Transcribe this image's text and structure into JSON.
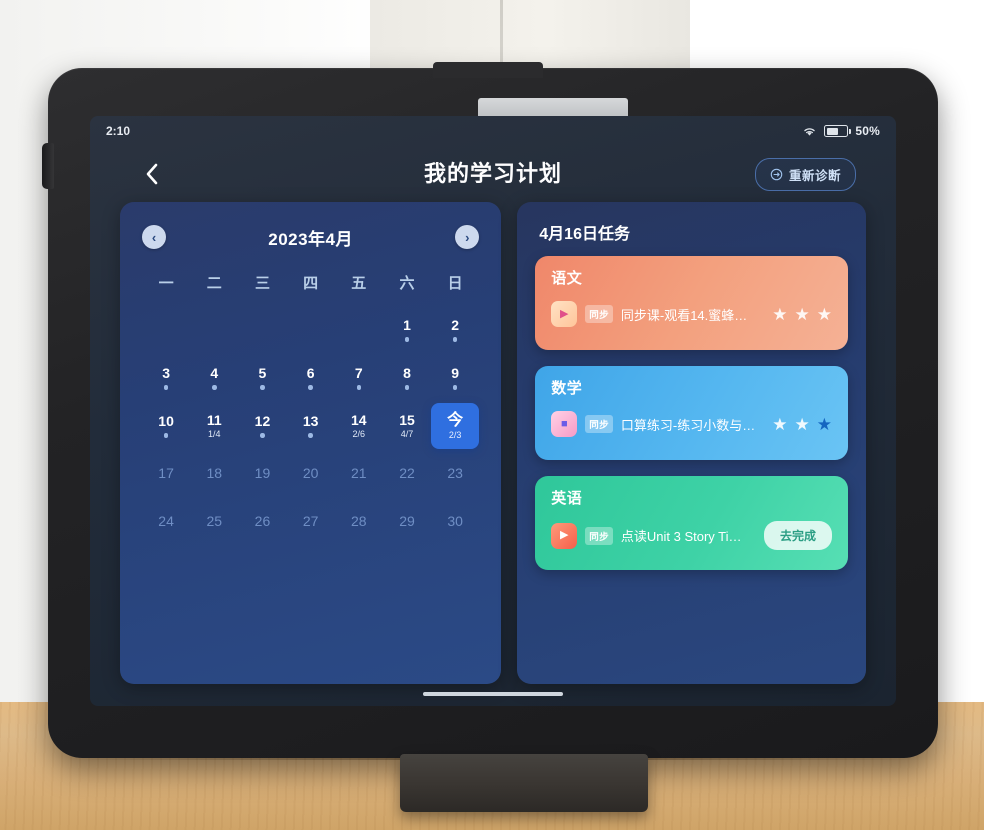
{
  "status_bar": {
    "time": "2:10",
    "wifi_icon": "wifi-icon",
    "battery_icon": "battery-icon",
    "battery_percent": "50%"
  },
  "nav": {
    "back_icon": "chevron-left-icon",
    "title": "我的学习计划",
    "rediagnose": {
      "icon": "refresh-circle-icon",
      "label": "重新诊断"
    }
  },
  "calendar": {
    "prev_icon": "chevron-left-icon",
    "next_icon": "chevron-right-icon",
    "month_title": "2023年4月",
    "weekdays": [
      "一",
      "二",
      "三",
      "四",
      "五",
      "六",
      "日"
    ],
    "leading_blanks": 5,
    "days": [
      {
        "num": "1",
        "dot": true,
        "frac": "",
        "state": "past"
      },
      {
        "num": "2",
        "dot": true,
        "frac": "",
        "state": "past"
      },
      {
        "num": "3",
        "dot": true,
        "frac": "",
        "state": "past"
      },
      {
        "num": "4",
        "dot": true,
        "frac": "",
        "state": "past"
      },
      {
        "num": "5",
        "dot": true,
        "frac": "",
        "state": "past"
      },
      {
        "num": "6",
        "dot": true,
        "frac": "",
        "state": "past"
      },
      {
        "num": "7",
        "dot": true,
        "frac": "",
        "state": "past"
      },
      {
        "num": "8",
        "dot": true,
        "frac": "",
        "state": "past"
      },
      {
        "num": "9",
        "dot": true,
        "frac": "",
        "state": "past"
      },
      {
        "num": "10",
        "dot": true,
        "frac": "",
        "state": "past"
      },
      {
        "num": "11",
        "dot": false,
        "frac": "1/4",
        "state": "past"
      },
      {
        "num": "12",
        "dot": true,
        "frac": "",
        "state": "past"
      },
      {
        "num": "13",
        "dot": true,
        "frac": "",
        "state": "past"
      },
      {
        "num": "14",
        "dot": false,
        "frac": "2/6",
        "state": "past"
      },
      {
        "num": "15",
        "dot": false,
        "frac": "4/7",
        "state": "past"
      },
      {
        "num": "今",
        "dot": false,
        "frac": "2/3",
        "state": "today"
      },
      {
        "num": "17",
        "dot": false,
        "frac": "",
        "state": "future"
      },
      {
        "num": "18",
        "dot": false,
        "frac": "",
        "state": "future"
      },
      {
        "num": "19",
        "dot": false,
        "frac": "",
        "state": "future"
      },
      {
        "num": "20",
        "dot": false,
        "frac": "",
        "state": "future"
      },
      {
        "num": "21",
        "dot": false,
        "frac": "",
        "state": "future"
      },
      {
        "num": "22",
        "dot": false,
        "frac": "",
        "state": "future"
      },
      {
        "num": "23",
        "dot": false,
        "frac": "",
        "state": "future"
      },
      {
        "num": "24",
        "dot": false,
        "frac": "",
        "state": "future"
      },
      {
        "num": "25",
        "dot": false,
        "frac": "",
        "state": "future"
      },
      {
        "num": "26",
        "dot": false,
        "frac": "",
        "state": "future"
      },
      {
        "num": "27",
        "dot": false,
        "frac": "",
        "state": "future"
      },
      {
        "num": "28",
        "dot": false,
        "frac": "",
        "state": "future"
      },
      {
        "num": "29",
        "dot": false,
        "frac": "",
        "state": "future"
      },
      {
        "num": "30",
        "dot": false,
        "frac": "",
        "state": "future"
      }
    ]
  },
  "tasks": {
    "header": "4月16日任务",
    "cards": [
      {
        "subject": "语文",
        "badge": "同步",
        "icon": "video-lesson-icon",
        "text": "同步课-观看14.蜜蜂（...",
        "stars": 3,
        "stars_filled": 0,
        "action": "",
        "theme": "card-chinese"
      },
      {
        "subject": "数学",
        "badge": "同步",
        "icon": "blocks-practice-icon",
        "text": "口算练习-练习小数与单...",
        "stars": 3,
        "stars_filled": 1,
        "action": "",
        "theme": "card-math"
      },
      {
        "subject": "英语",
        "badge": "同步",
        "icon": "audio-reading-icon",
        "text": "点读Unit 3 Story Time...",
        "stars": 0,
        "stars_filled": 0,
        "action": "去完成",
        "theme": "card-english"
      }
    ]
  },
  "colors": {
    "today_blue": "#2f6fe0",
    "panel_blue": "#2b4a86",
    "chinese_orange": "#f0876a",
    "math_blue": "#3fa5e8",
    "english_green": "#2fc79a"
  }
}
